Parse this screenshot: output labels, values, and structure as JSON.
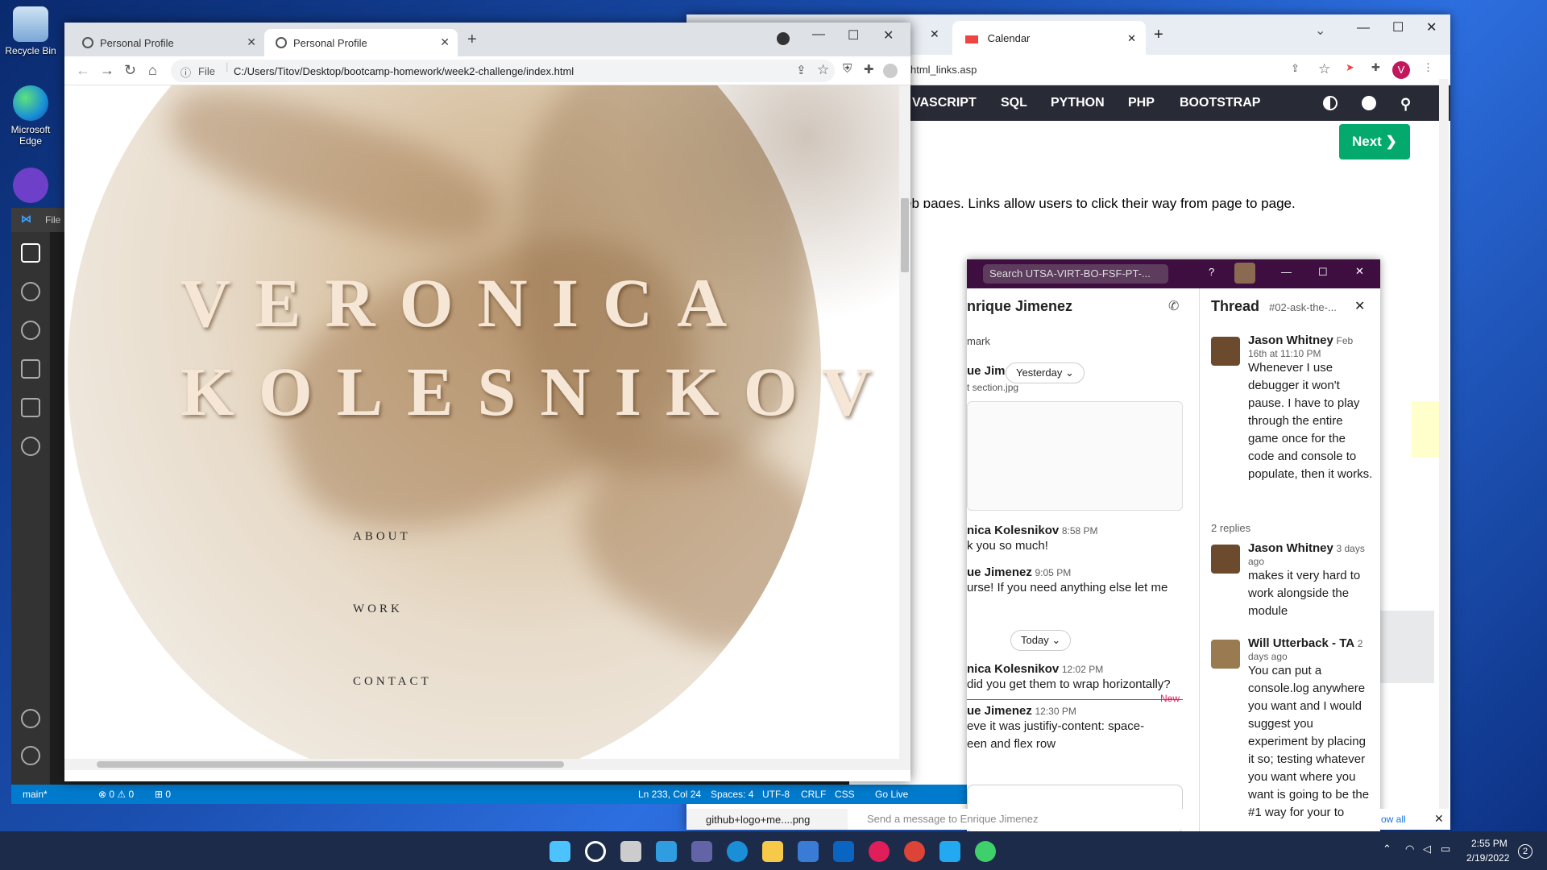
{
  "desktop": {
    "icons": [
      {
        "label": "Recycle Bin"
      },
      {
        "label": "Microsoft Edge"
      }
    ]
  },
  "bg_browser": {
    "tab_title": "Calendar",
    "address": "html_links.asp",
    "nav_items": [
      "VASCRIPT",
      "SQL",
      "PYTHON",
      "PHP",
      "BOOTSTRAP"
    ],
    "next_button": "Next ❯",
    "text": "eb pages. Links allow users to click their way from page to page.",
    "show_all": "ow all"
  },
  "vscode": {
    "menu_file": "File",
    "status": {
      "branch": "main*",
      "problems": "⊗ 0 ⚠ 0",
      "ports": "⊞ 0",
      "position": "Ln 233, Col 24",
      "spaces": "Spaces: 4",
      "encoding": "UTF-8",
      "eol": "CRLF",
      "language": "CSS",
      "golive": "Go Live"
    },
    "bottom_file": "github+logo+me....png"
  },
  "slack": {
    "search_placeholder": "Search UTSA-VIRT-BO-FSF-PT-...",
    "channel_name": "nrique Jimenez",
    "bookmark": "mark",
    "yesterday": "Yesterday",
    "today": "Today",
    "file_label": "t section.jpg",
    "new_label": "New",
    "compose_placeholder": "Send a message to Enrique Jimenez",
    "messages": [
      {
        "name": "ue Jim",
        "time": "",
        "text": ""
      },
      {
        "name": "nica Kolesnikov",
        "time": "8:58 PM",
        "text": "k you so much!"
      },
      {
        "name": "ue Jimenez",
        "time": "9:05 PM",
        "text": "urse! If you need anything else let me"
      },
      {
        "name": "nica Kolesnikov",
        "time": "12:02 PM",
        "text": "did you get them to wrap horizontally?"
      },
      {
        "name": "ue Jimenez",
        "time": "12:30 PM",
        "text": "eve it was justifiy-content: space-"
      },
      {
        "name": "",
        "time": "",
        "text": "een and flex row"
      }
    ],
    "thread": {
      "title": "Thread",
      "channel": "#02-ask-the-...",
      "replies": "2 replies",
      "items": [
        {
          "name": "Jason Whitney",
          "time": "Feb 16th at 11:10 PM",
          "text": "Whenever I use debugger it won't pause. I have to play through the entire game once for the code and console to populate, then it works."
        },
        {
          "name": "Jason Whitney",
          "time": "3 days ago",
          "text": "makes it very hard to work alongside the module"
        },
        {
          "name": "Will Utterback - TA",
          "time": "2 days ago",
          "text": "You can put a console.log anywhere you want and I would suggest you experiment by placing it so; testing whatever you want where you want is going to be the #1 way for your to"
        }
      ]
    }
  },
  "chrome": {
    "tabs": [
      {
        "title": "Personal Profile",
        "active": false
      },
      {
        "title": "Personal Profile",
        "active": true
      }
    ],
    "address_prefix": "File",
    "address": "C:/Users/Titov/Desktop/bootcamp-homework/week2-challenge/index.html"
  },
  "page": {
    "first_name": "VERONICA",
    "last_name": "KOLESNIKOV",
    "nav": [
      "ABOUT",
      "WORK",
      "CONTACT"
    ]
  },
  "taskbar": {
    "time": "2:55 PM",
    "date": "2/19/2022",
    "notif_count": "2"
  },
  "colors": {
    "slack_purple": "#3f0e40",
    "w3_green": "#04aa6d",
    "vscode_blue": "#007acc",
    "name_color": "#f5e6d6"
  }
}
